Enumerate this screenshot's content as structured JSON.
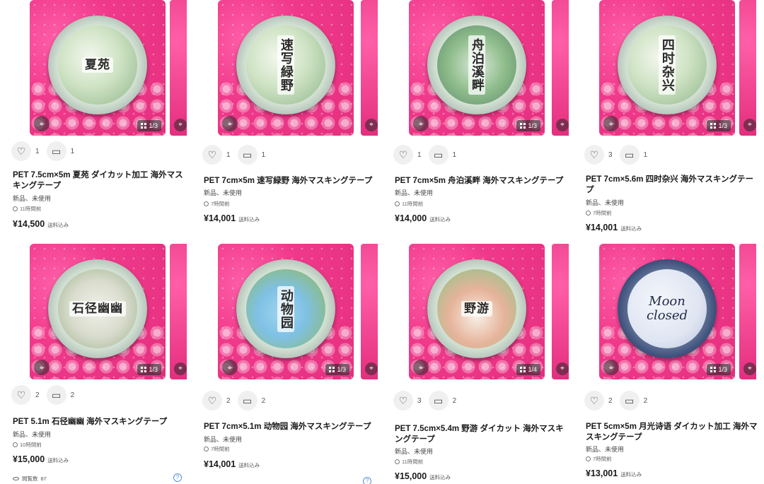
{
  "listings": [
    {
      "title": "PET 7.5cm×5m 夏苑 ダイカット加工 海外マスキングテープ",
      "tape_text": "夏苑",
      "vertical": false,
      "likes": "1",
      "comments": "1",
      "condition": "新品、未使用",
      "time": "11時間前",
      "price": "¥14,500",
      "tax": "送料込み",
      "count": "1/3"
    },
    {
      "title": "PET 7cm×5m 速写緑野 海外マスキングテープ",
      "tape_text": "速写緑野",
      "vertical": true,
      "likes": "1",
      "comments": "1",
      "condition": "新品、未使用",
      "time": "7時間前",
      "price": "¥14,001",
      "tax": "送料込み",
      "count": ""
    },
    {
      "title": "PET 7cm×5m 舟泊溪畔 海外マスキングテープ",
      "tape_text": "舟泊溪畔",
      "vertical": true,
      "likes": "1",
      "comments": "1",
      "condition": "新品、未使用",
      "time": "11時間前",
      "price": "¥14,000",
      "tax": "送料込み",
      "count": "1/3"
    },
    {
      "title": "PET 7cm×5.6m 四时杂兴 海外マスキングテープ",
      "tape_text": "四时杂兴",
      "vertical": true,
      "likes": "3",
      "comments": "1",
      "condition": "新品、未使用",
      "time": "7時間前",
      "price": "¥14,001",
      "tax": "送料込み",
      "count": "1/3"
    },
    {
      "title": "PET 5.1m 石径幽幽 海外マスキングテープ",
      "tape_text": "石径幽幽",
      "vertical": false,
      "likes": "2",
      "comments": "2",
      "condition": "新品、未使用",
      "time": "10時間前",
      "price": "¥15,000",
      "tax": "送料込み",
      "count": "1/3",
      "views_label": "閲覧数",
      "views": "87"
    },
    {
      "title": "PET 7cm×5.1m 动物园 海外マスキングテープ",
      "tape_text": "动物园",
      "vertical": true,
      "likes": "2",
      "comments": "2",
      "condition": "新品、未使用",
      "time": "7時間前",
      "price": "¥14,001",
      "tax": "送料込み",
      "count": "1/3"
    },
    {
      "title": "PET 7.5cm×5.4m 野游 ダイカット 海外マスキングテープ",
      "tape_text": "野游",
      "vertical": false,
      "likes": "3",
      "comments": "2",
      "condition": "新品、未使用",
      "time": "11時間前",
      "price": "¥15,000",
      "tax": "送料込み",
      "count": "1/4"
    },
    {
      "title": "PET 5cm×5m 月光诗语 ダイカット加工 海外マスキングテープ",
      "tape_text": "Moon closed",
      "vertical": false,
      "likes": "2",
      "comments": "2",
      "condition": "新品、未使用",
      "time": "7時間前",
      "price": "¥13,001",
      "tax": "送料込み",
      "count": "1/3"
    }
  ],
  "icons": {
    "like": "heart-icon",
    "comment": "comment-icon",
    "scan": "scan-icon",
    "time": "clock-icon",
    "grid": "image-grid-icon",
    "help": "help-icon"
  },
  "help_glyph": "?",
  "colors": {
    "thumb_pink": "#e42e7e",
    "help_blue": "#5a8fd8"
  }
}
